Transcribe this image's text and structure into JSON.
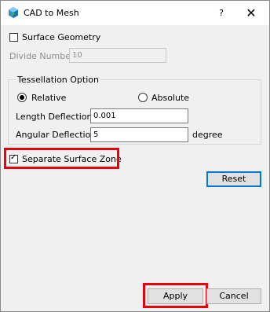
{
  "window": {
    "title": "CAD to Mesh",
    "help_glyph": "?",
    "close_glyph": "✕"
  },
  "surface_geometry": {
    "label": "Surface Geometry",
    "checked": false
  },
  "divide_number": {
    "label": "Divide Number",
    "value": "10",
    "enabled": false
  },
  "tessellation": {
    "group_label": "Tessellation Option",
    "mode_options": [
      "Relative",
      "Absolute"
    ],
    "selected_mode": "Relative",
    "length_deflection": {
      "label": "Length Deflection",
      "value": "0.001"
    },
    "angular_deflection": {
      "label": "Angular Deflection",
      "value": "5",
      "unit": "degree"
    }
  },
  "separate_surface_zone": {
    "label": "Separate Surface Zone",
    "checked": true,
    "checkmark_glyph": "✓"
  },
  "buttons": {
    "reset": "Reset",
    "apply": "Apply",
    "cancel": "Cancel"
  },
  "highlights": [
    "separate-surface-zone",
    "apply-button"
  ],
  "colors": {
    "highlight": "#e8000b",
    "default_button_border": "#0078d7",
    "dialog_background": "#f0f0f0"
  }
}
